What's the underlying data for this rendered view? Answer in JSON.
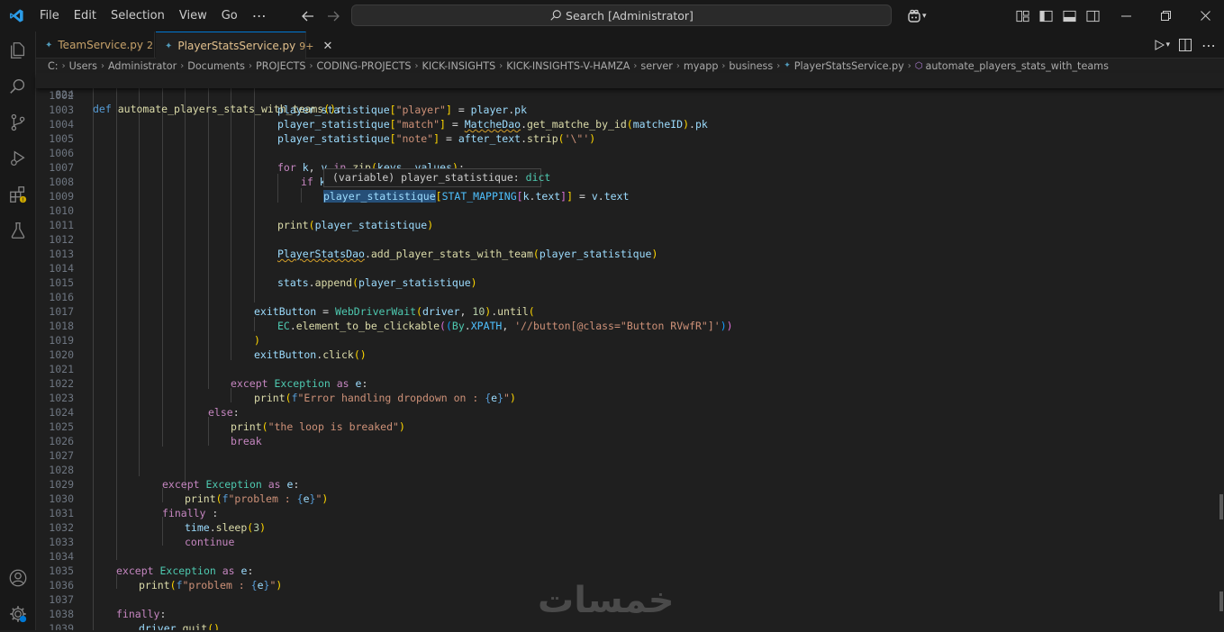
{
  "app": {
    "menu": [
      "File",
      "Edit",
      "Selection",
      "View",
      "Go"
    ],
    "search_placeholder": "Search [Administrator]"
  },
  "tabs": [
    {
      "name": "TeamService.py",
      "count": "2",
      "active": false
    },
    {
      "name": "PlayerStatsService.py",
      "count": "9+",
      "active": true
    }
  ],
  "breadcrumb": [
    "C:",
    "Users",
    "Administrator",
    "Documents",
    "PROJECTS",
    "CODING-PROJECTS",
    "KICK-INSIGHTS",
    "KICK-INSIGHTS-V-HAMZA",
    "server",
    "myapp",
    "business",
    "PlayerStatsService.py",
    "automate_players_stats_with_teams"
  ],
  "sticky": {
    "line_number": "824",
    "text": "def automate_players_stats_with_teams():"
  },
  "tooltip": {
    "prefix": "(variable) player_statistique: ",
    "type": "dict"
  },
  "editor": {
    "line_numbers": [
      "1002",
      "1003",
      "1004",
      "1005",
      "1006",
      "1007",
      "1008",
      "1009",
      "1010",
      "1011",
      "1012",
      "1013",
      "1014",
      "1015",
      "1016",
      "1017",
      "1018",
      "1019",
      "1020",
      "1021",
      "1022",
      "1023",
      "1024",
      "1025",
      "1026",
      "1027",
      "1028",
      "1029",
      "1030",
      "1031",
      "1032",
      "1033",
      "1034",
      "1035",
      "1036",
      "1037",
      "1038",
      "1039"
    ],
    "lines": [
      "",
      "player_statistique[\"player\"] = player.pk",
      "player_statistique[\"match\"] = MatcheDao.get_matche_by_id(matcheID).pk",
      "player_statistique[\"note\"] = after_text.strip('\\\"')",
      "",
      "for k, v in zip(keys, values):",
      "if k",
      "player_statistique[STAT_MAPPING[k.text]] = v.text",
      "",
      "print(player_statistique)",
      "",
      "PlayerStatsDao.add_player_stats_with_team(player_statistique)",
      "",
      "stats.append(player_statistique)",
      "",
      "exitButton = WebDriverWait(driver, 10).until(",
      "EC.element_to_be_clickable((By.XPATH, '//button[@class=\"Button RVwfR\"]'))",
      ")",
      "exitButton.click()",
      "",
      "except Exception as e:",
      "print(f\"Error handling dropdown on : {e}\")",
      "else:",
      "print(\"the loop is breaked\")",
      "break",
      "",
      "",
      "except Exception as e:",
      "print(f\"problem : {e}\")",
      "finally :",
      "time.sleep(3)",
      "continue",
      "",
      "except Exception as e:",
      "print(f\"problem : {e}\")",
      "",
      "finally:",
      "driver.quit()"
    ]
  },
  "watermark": "خمسات"
}
